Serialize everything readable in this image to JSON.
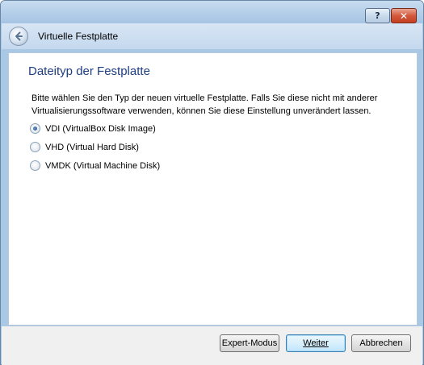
{
  "window": {
    "help_label": "?",
    "close_label": "✕"
  },
  "header": {
    "title": "Virtuelle Festplatte"
  },
  "page": {
    "title": "Dateityp der Festplatte",
    "description": "Bitte wählen Sie den Typ der neuen virtuelle Festplatte. Falls Sie diese nicht mit anderer Virtualisierungssoftware verwenden, können Sie diese Einstellung unverändert lassen.",
    "options": [
      {
        "label": "VDI (VirtualBox Disk Image)",
        "checked": true
      },
      {
        "label": "VHD (Virtual Hard Disk)",
        "checked": false
      },
      {
        "label": "VMDK (Virtual Machine Disk)",
        "checked": false
      }
    ]
  },
  "footer": {
    "expert_label": "Expert-Modus",
    "next_label": "Weiter",
    "cancel_label": "Abbrechen"
  },
  "colors": {
    "title_blue": "#1e3d82",
    "frame_blue": "#a9c8e6"
  }
}
